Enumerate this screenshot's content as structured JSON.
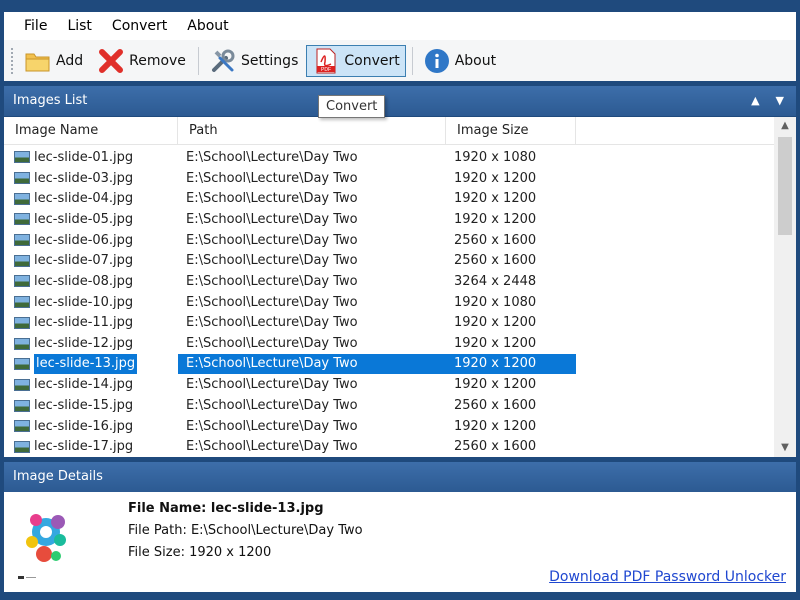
{
  "menu": [
    "File",
    "List",
    "Convert",
    "About"
  ],
  "toolbar": {
    "add": "Add",
    "remove": "Remove",
    "settings": "Settings",
    "convert": "Convert",
    "about": "About"
  },
  "tooltip": "Convert",
  "images_list": {
    "title": "Images List",
    "columns": [
      "Image Name",
      "Path",
      "Image Size"
    ],
    "rows": [
      {
        "name": "lec-slide-01.jpg",
        "path": "E:\\School\\Lecture\\Day Two",
        "size": "1920 x 1080"
      },
      {
        "name": "lec-slide-03.jpg",
        "path": "E:\\School\\Lecture\\Day Two",
        "size": "1920 x 1200"
      },
      {
        "name": "lec-slide-04.jpg",
        "path": "E:\\School\\Lecture\\Day Two",
        "size": "1920 x 1200"
      },
      {
        "name": "lec-slide-05.jpg",
        "path": "E:\\School\\Lecture\\Day Two",
        "size": "1920 x 1200"
      },
      {
        "name": "lec-slide-06.jpg",
        "path": "E:\\School\\Lecture\\Day Two",
        "size": "2560 x 1600"
      },
      {
        "name": "lec-slide-07.jpg",
        "path": "E:\\School\\Lecture\\Day Two",
        "size": "2560 x 1600"
      },
      {
        "name": "lec-slide-08.jpg",
        "path": "E:\\School\\Lecture\\Day Two",
        "size": "3264 x 2448"
      },
      {
        "name": "lec-slide-10.jpg",
        "path": "E:\\School\\Lecture\\Day Two",
        "size": "1920 x 1080"
      },
      {
        "name": "lec-slide-11.jpg",
        "path": "E:\\School\\Lecture\\Day Two",
        "size": "1920 x 1200"
      },
      {
        "name": "lec-slide-12.jpg",
        "path": "E:\\School\\Lecture\\Day Two",
        "size": "1920 x 1200"
      },
      {
        "name": "lec-slide-13.jpg",
        "path": "E:\\School\\Lecture\\Day Two",
        "size": "1920 x 1200",
        "selected": true
      },
      {
        "name": "lec-slide-14.jpg",
        "path": "E:\\School\\Lecture\\Day Two",
        "size": "1920 x 1200"
      },
      {
        "name": "lec-slide-15.jpg",
        "path": "E:\\School\\Lecture\\Day Two",
        "size": "2560 x 1600"
      },
      {
        "name": "lec-slide-16.jpg",
        "path": "E:\\School\\Lecture\\Day Two",
        "size": "1920 x 1200"
      },
      {
        "name": "lec-slide-17.jpg",
        "path": "E:\\School\\Lecture\\Day Two",
        "size": "2560 x 1600"
      }
    ]
  },
  "image_details": {
    "title": "Image Details",
    "file_name": "File Name: lec-slide-13.jpg",
    "file_path": "File Path: E:\\School\\Lecture\\Day Two",
    "file_size": "File Size: 1920 x 1200",
    "link": "Download PDF Password Unlocker"
  },
  "colors": {
    "frame": "#1f4a7d",
    "panel_header": "#3d6eaa",
    "selection": "#0a78d7",
    "link": "#1f47d0"
  },
  "icons": [
    "folder-add-icon",
    "red-x-icon",
    "tools-icon",
    "pdf-icon",
    "info-icon",
    "up-arrow-icon",
    "down-arrow-icon"
  ]
}
